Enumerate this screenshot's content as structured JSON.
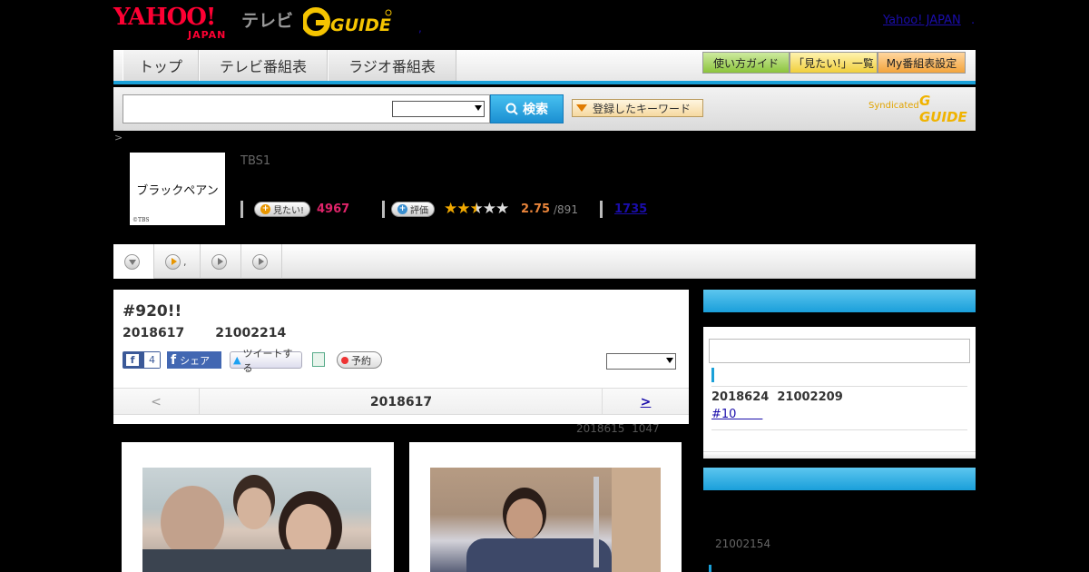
{
  "header": {
    "yahoo_logo": "YAHOO!",
    "japan": "JAPAN",
    "tv_label": "テレビ",
    "gguide_logo": "G-GUIDE",
    "stray_dot": ",",
    "yahoo_japan_link": "Yahoo! JAPAN",
    "link_dot": "."
  },
  "nav": {
    "tabs": [
      "トップ",
      "テレビ番組表",
      "ラジオ番組表"
    ],
    "buttons": [
      "使い方ガイド",
      "「見たい!」一覧",
      "My番組表設定"
    ]
  },
  "search": {
    "placeholder": "",
    "select_value": "",
    "search_button": "検索",
    "keyword_button": "登録したキーワード",
    "syndicated": "Syndicated",
    "gguide_mark": "G GUIDE"
  },
  "breadcrumb": ">",
  "program": {
    "thumb_title": "ブラックペアン",
    "thumb_credit": "©TBS",
    "channel": "TBS1",
    "want_label": "見たい!",
    "want_count": "4967",
    "rate_label": "評価",
    "rating": "2.75",
    "rating_count": "/891",
    "comment_count": "1735"
  },
  "subtabs": [
    "",
    ",",
    "",
    ""
  ],
  "episode": {
    "title": "#920!!",
    "date": "2018617       21002214",
    "fb_like_count": "4",
    "fb_share": "シェア",
    "tweet": "ツイートする",
    "reserve": "予約",
    "select_value": "",
    "prev": "<",
    "current": "2018617",
    "next": ">",
    "update_time": "2018615  1047"
  },
  "sidebar": {
    "next_date": "2018624  21002209",
    "next_link": "#10       ",
    "related_date": "21002154"
  },
  "colors": {
    "accent_blue": "#1aa0d8",
    "want_pink": "#e0246a",
    "rating_orange": "#e8843a",
    "star_gold": "#f0a800"
  }
}
